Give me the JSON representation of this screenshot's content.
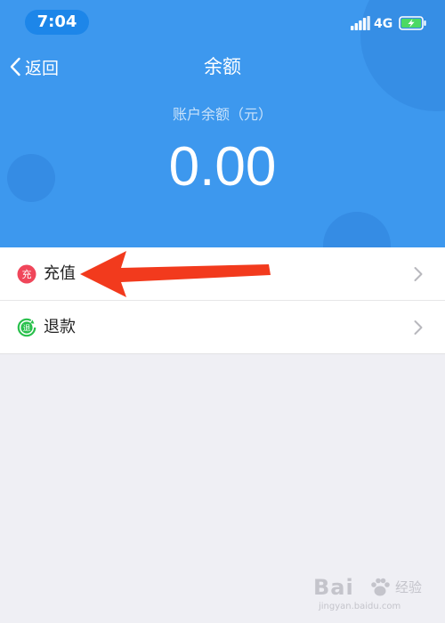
{
  "status_bar": {
    "time": "7:04",
    "network": "4G",
    "signal_icon": "signal-bars-icon",
    "battery_icon": "battery-charging-icon"
  },
  "nav": {
    "back_label": "返回",
    "back_icon": "chevron-left-icon",
    "title": "余额"
  },
  "balance": {
    "label": "账户余额（元）",
    "value": "0.00"
  },
  "menu": {
    "items": [
      {
        "label": "充值",
        "icon_text": "充",
        "icon": "recharge-icon",
        "color": "#f0465a"
      },
      {
        "label": "退款",
        "icon_text": "退",
        "icon": "refund-icon",
        "color": "#29c04c"
      }
    ]
  },
  "annotation": {
    "arrow_color": "#f23a1d"
  },
  "watermark": {
    "brand": "Bai",
    "sub": "经验",
    "domain": "jingyan.baidu.com"
  },
  "colors": {
    "header": "#3d98ee",
    "background": "#efeff4"
  }
}
